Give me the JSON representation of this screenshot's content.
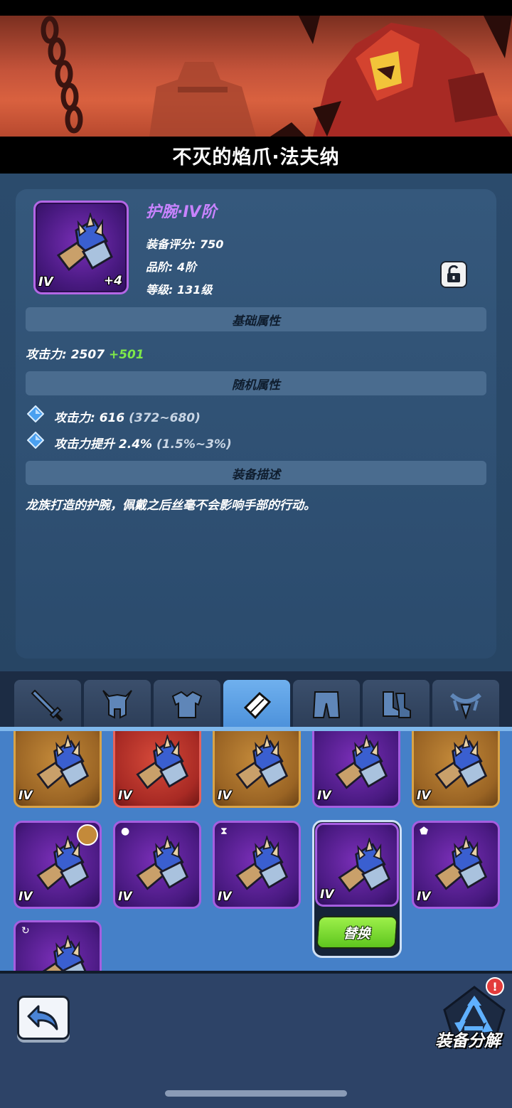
{
  "hero_title": "不灭的焰爪·法夫纳",
  "item": {
    "name": "护腕·IV阶",
    "tier_badge": "IV",
    "plus": "+4",
    "score": "装备评分: 750",
    "grade": "品阶: 4阶",
    "level": "等级: 131级"
  },
  "sections": {
    "base": "基础属性",
    "random": "随机属性",
    "desc": "装备描述"
  },
  "base_attr": {
    "label": "攻击力: 2507",
    "bonus": "+501"
  },
  "random_attrs": [
    {
      "text": "攻击力: 616",
      "range": "(372~680)"
    },
    {
      "text": "攻击力提升 2.4%",
      "range": "(1.5%~3%)"
    }
  ],
  "description": "龙族打造的护腕，佩戴之后丝毫不会影响手部的行动。",
  "tabs": [
    "weapon",
    "helmet",
    "armor",
    "bracer",
    "pants",
    "boots",
    "necklace"
  ],
  "grid": {
    "tier": "IV",
    "replace_label": "替换"
  },
  "bottom": {
    "dismantle_label": "装备分解",
    "alert": "!"
  },
  "colors": {
    "accent_purple": "#c883ff",
    "bonus_green": "#7ee84a",
    "active_tab": "#4b90da",
    "replace_green": "#5ec51e"
  }
}
